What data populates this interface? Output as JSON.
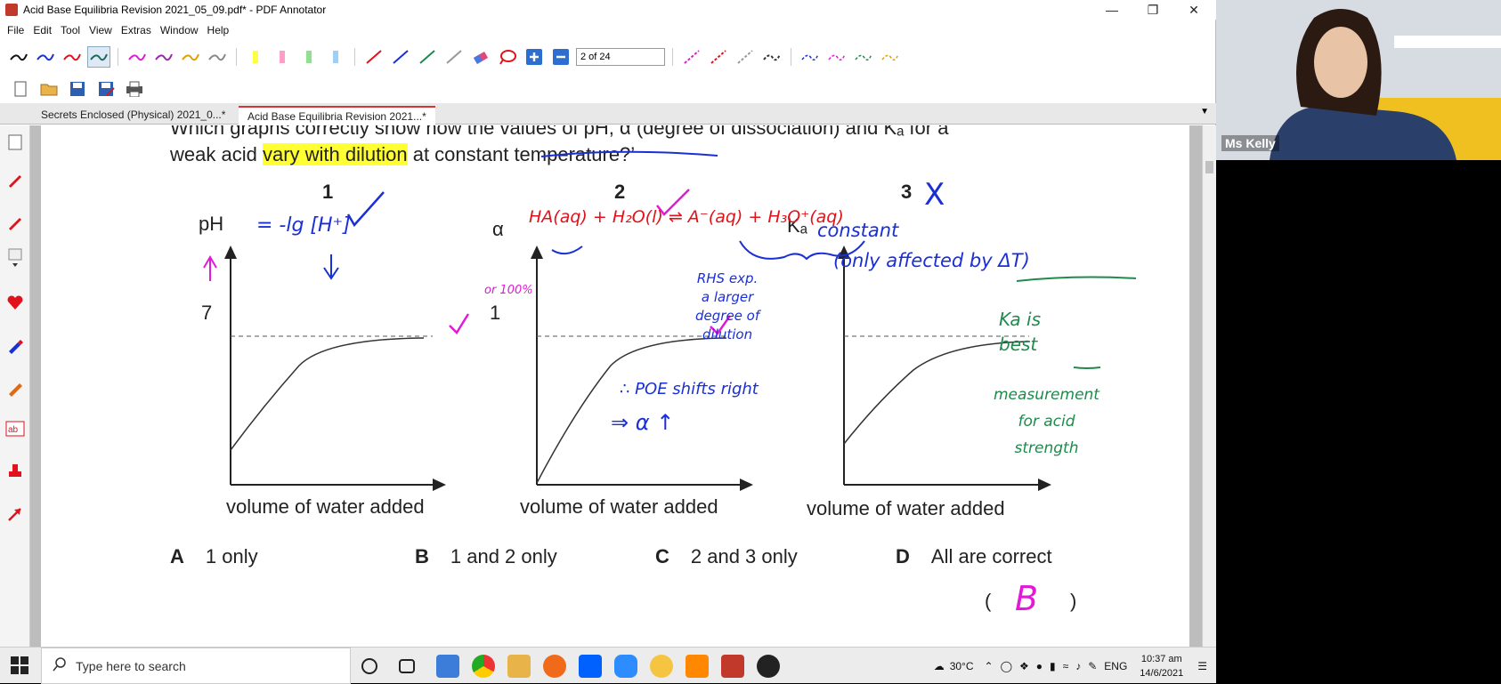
{
  "window": {
    "title": "Acid Base Equilibria Revision 2021_05_09.pdf* - PDF Annotator"
  },
  "menu": {
    "items": [
      "File",
      "Edit",
      "Tool",
      "View",
      "Extras",
      "Window",
      "Help"
    ]
  },
  "toolbar": {
    "page_indicator": "2 of 24"
  },
  "tabs": [
    {
      "label": "Secrets Enclosed (Physical) 2021_0...*"
    },
    {
      "label": "Acid Base Equilibria Revision 2021...*"
    }
  ],
  "document": {
    "question_line1": "Which graphs correctly show how the values of pH, α (degree of dissociation) and Kₐ for a",
    "question_line2_a": "weak acid ",
    "question_line2_hl": "vary with dilution",
    "question_line2_b": " at constant temperature?’",
    "graphs": [
      {
        "number": "1",
        "ylabel": "pH",
        "yvalue": "7",
        "xlabel": "volume of water added"
      },
      {
        "number": "2",
        "ylabel": "α",
        "yvalue": "1",
        "xlabel": "volume of water added"
      },
      {
        "number": "3",
        "ylabel": "Kₐ",
        "yvalue": "",
        "xlabel": "volume of water added"
      }
    ],
    "options": [
      {
        "letter": "A",
        "text": "1 only"
      },
      {
        "letter": "B",
        "text": "1 and 2 only"
      },
      {
        "letter": "C",
        "text": "2 and 3 only"
      },
      {
        "letter": "D",
        "text": "All are correct"
      }
    ],
    "answer_left": "(",
    "answer_right": ")"
  },
  "annotations": {
    "ph_formula": "= -lg [H⁺]",
    "eq": "HA(aq) + H₂O(l) ⇌ A⁻(aq) + H₃O⁺(aq)",
    "constant": "constant",
    "only_affected": "(only affected by ΔT)",
    "rhs": [
      "RHS exp.",
      "a larger",
      "degree of",
      "dilution"
    ],
    "poe": "∴ POE shifts right",
    "alpha_up": "⇒  α ↑",
    "ka_best": [
      "Ka is",
      "best"
    ],
    "measurement": [
      "measurement",
      "for acid",
      "strength"
    ],
    "or100": "or 100%",
    "answer": "B",
    "cross": "X",
    "colors": {
      "blue": "#1a2fd6",
      "red": "#e0121b",
      "magenta": "#e01ad6",
      "green": "#1f8a4c"
    }
  },
  "taskbar": {
    "search_placeholder": "Type here to search",
    "temperature": "30°C",
    "language": "ENG",
    "time": "10:37 am",
    "date": "14/6/2021"
  },
  "video": {
    "name": "Ms Kelly"
  }
}
